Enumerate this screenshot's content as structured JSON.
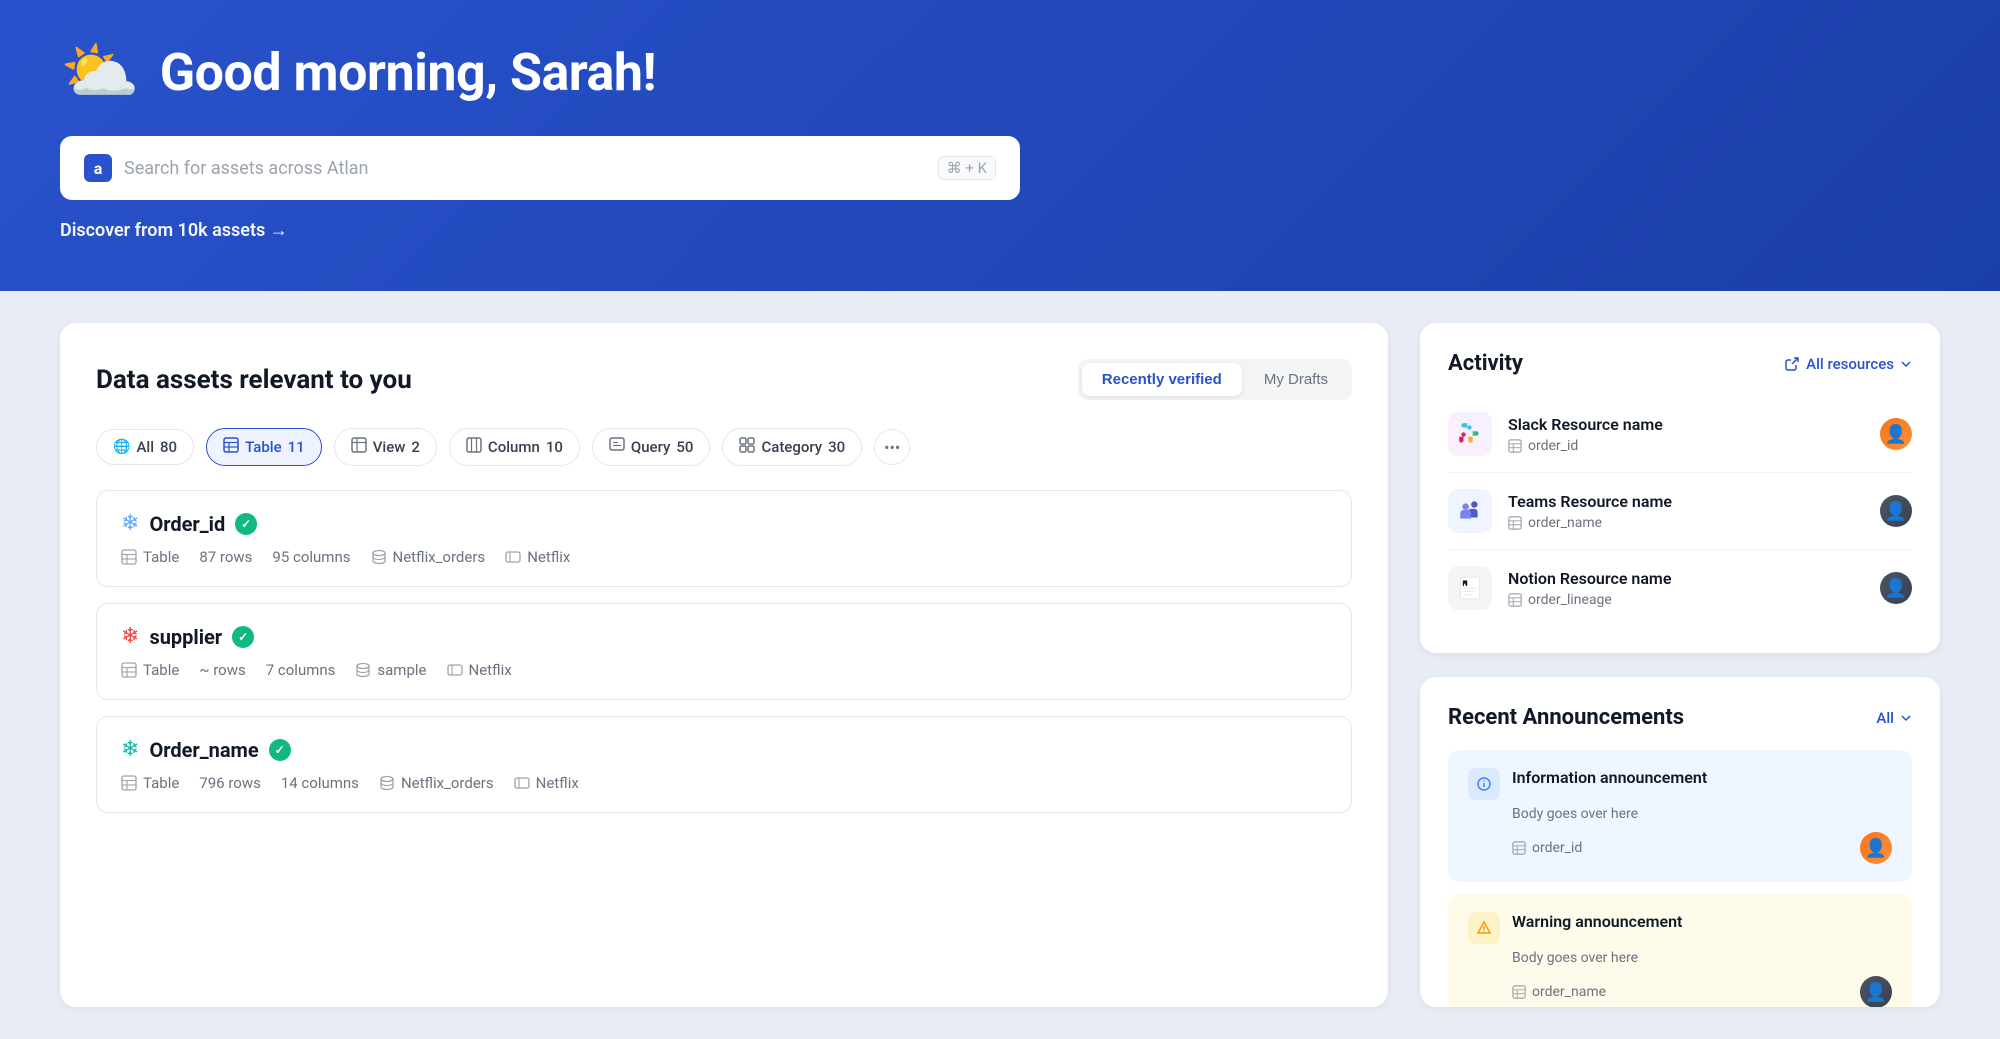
{
  "hero": {
    "greeting": "Good morning, Sarah!",
    "emoji": "⛅",
    "search_placeholder": "Search for assets across Atlan",
    "search_shortcut": "⌘ + K",
    "discover_label": "Discover from 10k assets →"
  },
  "left_panel": {
    "title": "Data assets relevant to you",
    "tabs": [
      {
        "label": "Recently verified",
        "active": true
      },
      {
        "label": "My Drafts",
        "active": false
      }
    ],
    "filters": [
      {
        "label": "All",
        "count": "80",
        "active": false,
        "icon": "🌐"
      },
      {
        "label": "Table",
        "count": "11",
        "active": true,
        "icon": "⊞"
      },
      {
        "label": "View",
        "count": "2",
        "active": false,
        "icon": "⊟"
      },
      {
        "label": "Column",
        "count": "10",
        "active": false,
        "icon": "⊡"
      },
      {
        "label": "Query",
        "count": "50",
        "active": false,
        "icon": "⊠"
      },
      {
        "label": "Category",
        "count": "30",
        "active": false,
        "icon": "⊟"
      }
    ],
    "assets": [
      {
        "name": "Order_id",
        "verified": true,
        "type": "Table",
        "rows": "87 rows",
        "columns": "95 columns",
        "schema": "Netflix_orders",
        "source": "Netflix",
        "icon_color": "blue"
      },
      {
        "name": "supplier",
        "verified": true,
        "type": "Table",
        "rows": "~ rows",
        "columns": "7 columns",
        "schema": "sample",
        "source": "Netflix",
        "icon_color": "red"
      },
      {
        "name": "Order_name",
        "verified": true,
        "type": "Table",
        "rows": "796 rows",
        "columns": "14 columns",
        "schema": "Netflix_orders",
        "source": "Netflix",
        "icon_color": "teal"
      }
    ]
  },
  "activity_panel": {
    "title": "Activity",
    "all_resources_label": "All resources",
    "items": [
      {
        "platform": "Slack",
        "resource_name": "Slack Resource name",
        "asset_name": "order_id",
        "logo": "slack"
      },
      {
        "platform": "Teams",
        "resource_name": "Teams Resource name",
        "asset_name": "order_name",
        "logo": "teams"
      },
      {
        "platform": "Notion",
        "resource_name": "Notion Resource name",
        "asset_name": "order_lineage",
        "logo": "notion"
      }
    ]
  },
  "announcements_panel": {
    "title": "Recent Announcements",
    "all_label": "All",
    "items": [
      {
        "type": "info",
        "title": "Information announcement",
        "body": "Body goes over here",
        "asset": "order_id"
      },
      {
        "type": "warning",
        "title": "Warning announcement",
        "body": "Body goes over here",
        "asset": "order_name"
      }
    ]
  }
}
